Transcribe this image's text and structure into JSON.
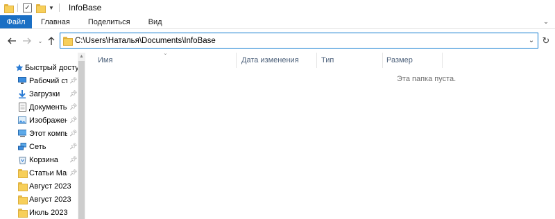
{
  "window": {
    "title": "InfoBase"
  },
  "ribbon": {
    "tabs": [
      "Файл",
      "Главная",
      "Поделиться",
      "Вид"
    ]
  },
  "address": {
    "path": "C:\\Users\\Наталья\\Documents\\InfoBase"
  },
  "nav": {
    "quick_access": "Быстрый доступ",
    "items": [
      {
        "label": "Рабочий стол",
        "icon": "desktop-icon",
        "pinned": true
      },
      {
        "label": "Загрузки",
        "icon": "downloads-icon",
        "pinned": true
      },
      {
        "label": "Документы",
        "icon": "documents-icon",
        "pinned": true
      },
      {
        "label": "Изображения",
        "icon": "pictures-icon",
        "pinned": true
      },
      {
        "label": "Этот компьютер",
        "icon": "this-pc-icon",
        "pinned": true
      },
      {
        "label": "Сеть",
        "icon": "network-icon",
        "pinned": true
      },
      {
        "label": "Корзина",
        "icon": "recycle-bin-icon",
        "pinned": true
      },
      {
        "label": "Статьи Макс",
        "icon": "folder-icon",
        "pinned": true
      },
      {
        "label": "Август 2023",
        "icon": "folder-icon",
        "pinned": false
      },
      {
        "label": "Август 2023",
        "icon": "folder-icon",
        "pinned": false
      },
      {
        "label": "Июль 2023",
        "icon": "folder-icon",
        "pinned": false
      }
    ]
  },
  "columns": [
    "Имя",
    "Дата изменения",
    "Тип",
    "Размер"
  ],
  "empty_message": "Эта папка пуста.",
  "colors": {
    "accent": "#1a6fc4",
    "address_border": "#0b79d0",
    "header_text": "#4c607a"
  }
}
